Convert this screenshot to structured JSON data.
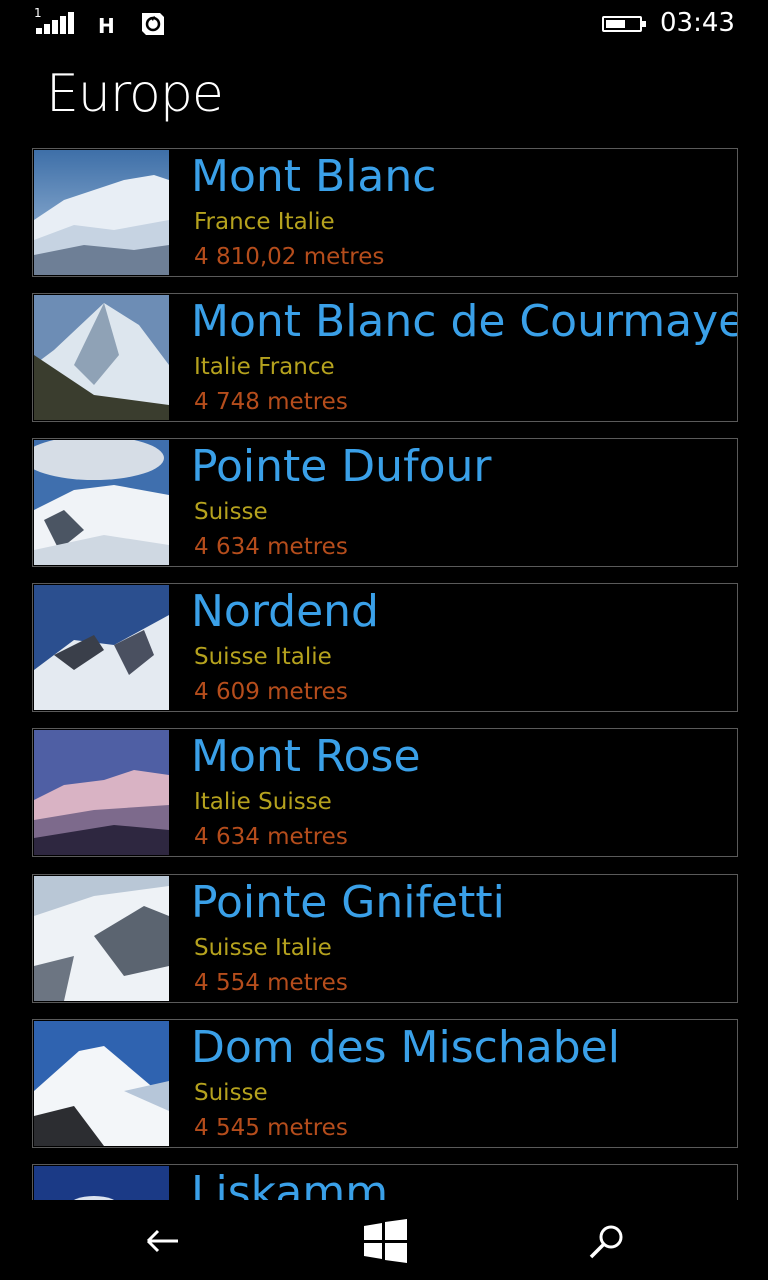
{
  "status": {
    "network": "H",
    "signal_sub": "1",
    "time": "03:43",
    "battery_level": 0.6
  },
  "page": {
    "title": "Europe"
  },
  "mountains": [
    {
      "name": "Mont Blanc",
      "countries": "France Italie",
      "height": "4 810,02 metres",
      "thumb": "snowy-massif"
    },
    {
      "name": "Mont Blanc de Courmayeur",
      "countries": "Italie France",
      "height": "4 748 metres",
      "thumb": "steep-peak"
    },
    {
      "name": "Pointe Dufour",
      "countries": "Suisse",
      "height": "4 634 metres",
      "thumb": "cloudy-glacier"
    },
    {
      "name": "Nordend",
      "countries": "Suisse Italie",
      "height": "4 609 metres",
      "thumb": "blue-ridge"
    },
    {
      "name": "Mont Rose",
      "countries": "Italie Suisse",
      "height": "4 634 metres",
      "thumb": "pink-sunset"
    },
    {
      "name": "Pointe Gnifetti",
      "countries": "Suisse Italie",
      "height": "4 554 metres",
      "thumb": "pale-slope"
    },
    {
      "name": "Dom des Mischabel",
      "countries": "Suisse",
      "height": "4 545 metres",
      "thumb": "white-summit"
    },
    {
      "name": "Liskamm",
      "countries": "",
      "height": "",
      "thumb": "dark-blue"
    }
  ],
  "navbar": {
    "back": "back-icon",
    "home": "windows-icon",
    "search": "search-icon"
  }
}
